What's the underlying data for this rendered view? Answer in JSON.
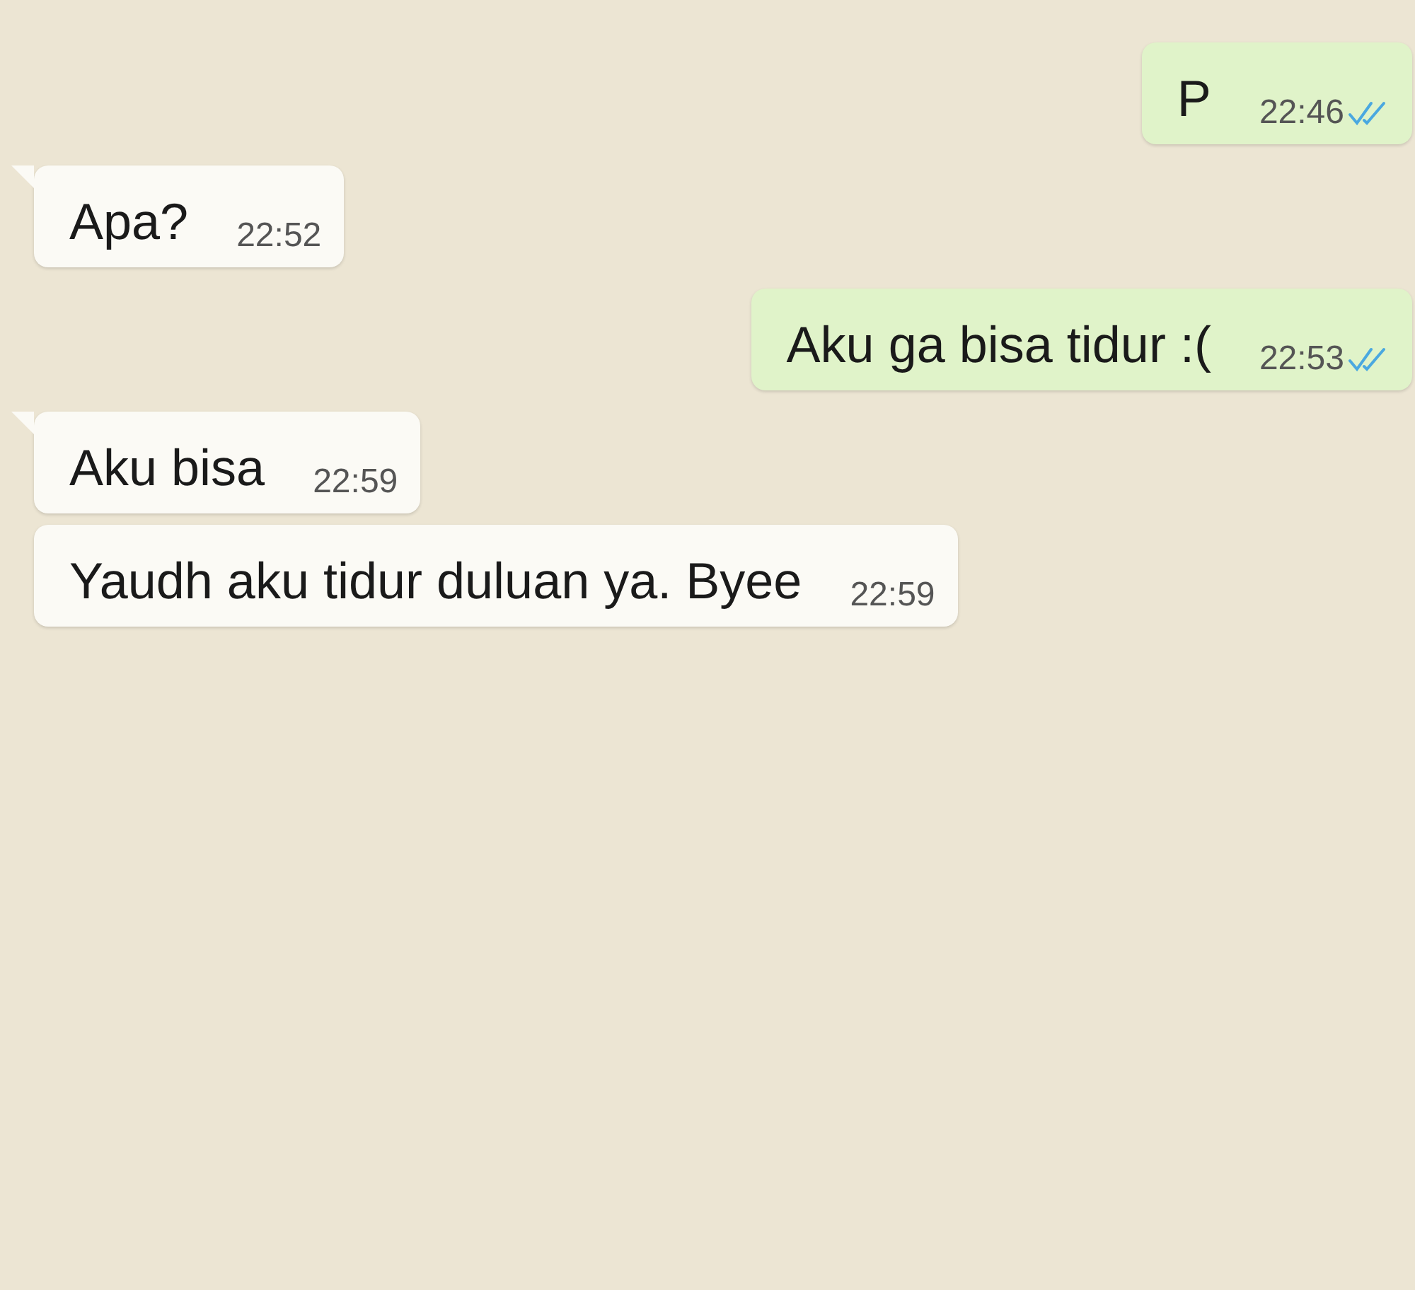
{
  "messages": [
    {
      "kind": "outgoing",
      "text": "P",
      "time": "22:46",
      "tail": false,
      "read": true
    },
    {
      "kind": "incoming",
      "text": "Apa?",
      "time": "22:52",
      "tail": true
    },
    {
      "kind": "outgoing",
      "text": "Aku ga bisa tidur :(",
      "time": "22:53",
      "tail": false,
      "read": true
    },
    {
      "kind": "incoming",
      "text": "Aku bisa",
      "time": "22:59",
      "tail": true
    },
    {
      "kind": "incoming",
      "text": "Yaudh aku tidur duluan ya. Byee",
      "time": "22:59",
      "tail": false
    }
  ]
}
